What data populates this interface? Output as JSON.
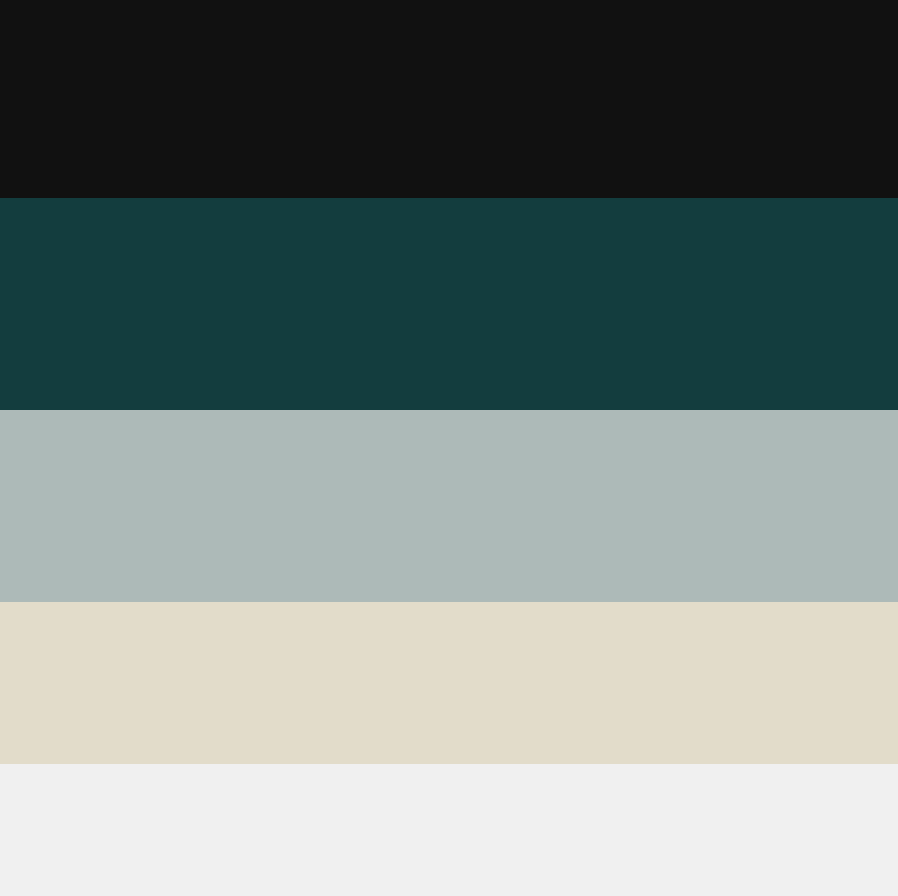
{
  "palette": {
    "swatches": [
      {
        "color": "#111111"
      },
      {
        "color": "#133d3e"
      },
      {
        "color": "#adbab8"
      },
      {
        "color": "#e2dcca"
      },
      {
        "color": "#f0f0f0"
      }
    ]
  }
}
